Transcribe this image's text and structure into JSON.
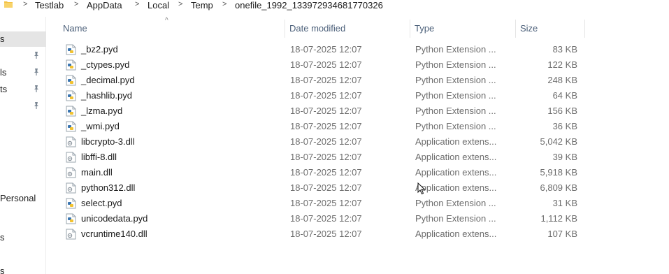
{
  "breadcrumb": {
    "items": [
      "Testlab",
      "AppData",
      "Local",
      "Temp",
      "onefile_1992_133972934681770326"
    ],
    "separator": ">"
  },
  "nav": {
    "items": [
      {
        "label": "s",
        "selected": true,
        "pinned": false
      },
      {
        "label": "",
        "selected": false,
        "pinned": true
      },
      {
        "label": "ls",
        "selected": false,
        "pinned": true
      },
      {
        "label": "ts",
        "selected": false,
        "pinned": true
      },
      {
        "label": "",
        "selected": false,
        "pinned": true
      },
      {
        "label": "Personal",
        "selected": false,
        "pinned": false
      },
      {
        "label": "s",
        "selected": false,
        "pinned": false
      },
      {
        "label": "s",
        "selected": false,
        "pinned": false
      }
    ]
  },
  "columns": {
    "name": "Name",
    "date": "Date modified",
    "type": "Type",
    "size": "Size",
    "sort_indicator": "^"
  },
  "files": [
    {
      "name": "_bz2.pyd",
      "date": "18-07-2025 12:07",
      "type": "Python Extension ...",
      "size": "83 KB",
      "icon": "python-file-icon"
    },
    {
      "name": "_ctypes.pyd",
      "date": "18-07-2025 12:07",
      "type": "Python Extension ...",
      "size": "122 KB",
      "icon": "python-file-icon"
    },
    {
      "name": "_decimal.pyd",
      "date": "18-07-2025 12:07",
      "type": "Python Extension ...",
      "size": "248 KB",
      "icon": "python-file-icon"
    },
    {
      "name": "_hashlib.pyd",
      "date": "18-07-2025 12:07",
      "type": "Python Extension ...",
      "size": "64 KB",
      "icon": "python-file-icon"
    },
    {
      "name": "_lzma.pyd",
      "date": "18-07-2025 12:07",
      "type": "Python Extension ...",
      "size": "156 KB",
      "icon": "python-file-icon"
    },
    {
      "name": "_wmi.pyd",
      "date": "18-07-2025 12:07",
      "type": "Python Extension ...",
      "size": "36 KB",
      "icon": "python-file-icon"
    },
    {
      "name": "libcrypto-3.dll",
      "date": "18-07-2025 12:07",
      "type": "Application extens...",
      "size": "5,042 KB",
      "icon": "dll-file-icon"
    },
    {
      "name": "libffi-8.dll",
      "date": "18-07-2025 12:07",
      "type": "Application extens...",
      "size": "39 KB",
      "icon": "dll-file-icon"
    },
    {
      "name": "main.dll",
      "date": "18-07-2025 12:07",
      "type": "Application extens...",
      "size": "5,918 KB",
      "icon": "dll-file-icon"
    },
    {
      "name": "python312.dll",
      "date": "18-07-2025 12:07",
      "type": "Application extens...",
      "size": "6,809 KB",
      "icon": "dll-file-icon"
    },
    {
      "name": "select.pyd",
      "date": "18-07-2025 12:07",
      "type": "Python Extension ...",
      "size": "31 KB",
      "icon": "python-file-icon"
    },
    {
      "name": "unicodedata.pyd",
      "date": "18-07-2025 12:07",
      "type": "Python Extension ...",
      "size": "1,112 KB",
      "icon": "python-file-icon"
    },
    {
      "name": "vcruntime140.dll",
      "date": "18-07-2025 12:07",
      "type": "Application extens...",
      "size": "107 KB",
      "icon": "dll-file-icon"
    }
  ],
  "colors": {
    "header_text": "#4c607a",
    "detail_text": "#6d6d6d",
    "nav_selected": "#e5e5e5",
    "folder_yellow": "#f3c244"
  }
}
